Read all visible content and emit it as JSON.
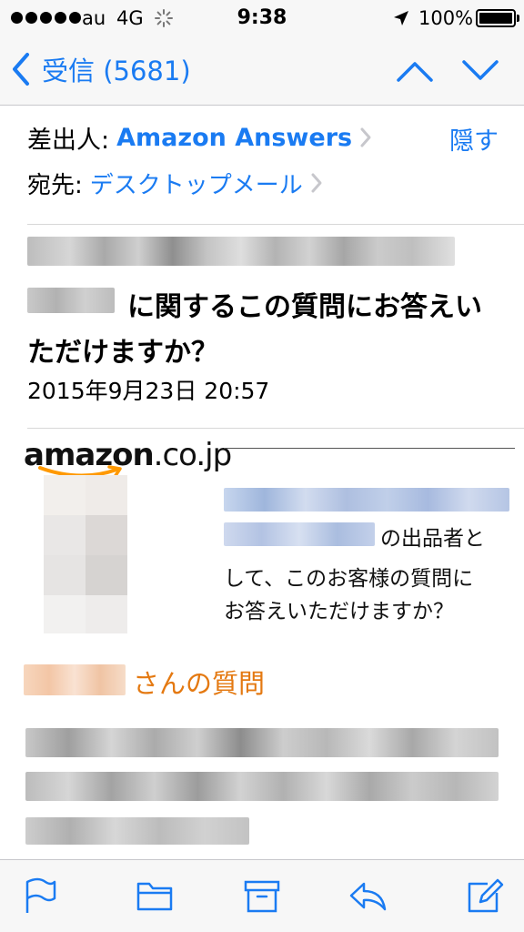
{
  "status": {
    "carrier": "au",
    "network": "4G",
    "time": "9:38",
    "battery": "100%",
    "battery_level": 1.0
  },
  "nav": {
    "back_label": "受信 (5681)",
    "icons": [
      "chevron-left-icon",
      "chevron-up-icon",
      "chevron-down-icon"
    ]
  },
  "header": {
    "from_label": "差出人:",
    "from_name": "Amazon Answers",
    "hide_label": "隠す",
    "to_label": "宛先:",
    "to_name": "デスクトップメール"
  },
  "subject": {
    "line2_visible": "に関するこの質問にお答えい",
    "line3": "ただけますか？",
    "date": "2015年9月23日 20:57"
  },
  "body": {
    "logo_main": "amazon",
    "logo_domain": ".co.jp",
    "question_line2_visible": "の出品者と",
    "question_line3": "して、このお客様の質問に",
    "question_line4": "お答えいただけますか？",
    "asker_suffix": "さんの質問"
  },
  "toolbar": {
    "icons": [
      "flag-icon",
      "folder-icon",
      "archive-icon",
      "reply-icon",
      "compose-icon"
    ]
  },
  "colors": {
    "link": "#1a7bf2",
    "amazon_orange": "#e47911",
    "bar_background": "#f7f7f7"
  }
}
